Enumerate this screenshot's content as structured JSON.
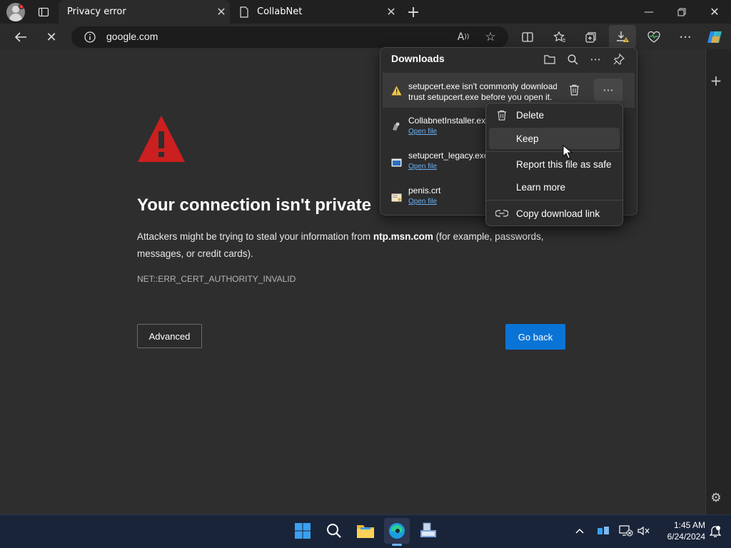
{
  "browser": {
    "tabs": [
      {
        "label": "Privacy error",
        "active": true
      },
      {
        "label": "CollabNet",
        "active": false
      }
    ],
    "address": "google.com",
    "accent_color": "#0a74d6"
  },
  "error_page": {
    "heading": "Your connection isn't private",
    "paragraph_pre": "Attackers might be trying to steal your information from ",
    "paragraph_host": "ntp.msn.com",
    "paragraph_post": " (for example, passwords, messages, or credit cards).",
    "error_code": "NET::ERR_CERT_AUTHORITY_INVALID",
    "advanced_label": "Advanced",
    "go_back_label": "Go back"
  },
  "downloads": {
    "title": "Downloads",
    "items": [
      {
        "name": "setupcert.exe isn't commonly downloaded. Make sure you",
        "name2": "trust setupcert.exe before you open it.",
        "link": "",
        "icon": "warning-icon"
      },
      {
        "name": "CollabnetInstaller.exe",
        "link": "Open file",
        "icon": "installer-icon"
      },
      {
        "name": "setupcert_legacy.exe",
        "link": "Open file",
        "icon": "exe-icon"
      },
      {
        "name": "penis.crt",
        "link": "Open file",
        "icon": "certificate-icon"
      }
    ]
  },
  "context_menu": {
    "items": [
      {
        "label": "Delete",
        "icon": "trash-icon"
      },
      {
        "label": "Keep",
        "icon": ""
      },
      {
        "label": "Report this file as safe",
        "icon": ""
      },
      {
        "label": "Learn more",
        "icon": ""
      },
      {
        "label": "Copy download link",
        "icon": "link-icon"
      }
    ]
  },
  "taskbar": {
    "time": "1:45 AM",
    "date": "6/24/2024"
  }
}
